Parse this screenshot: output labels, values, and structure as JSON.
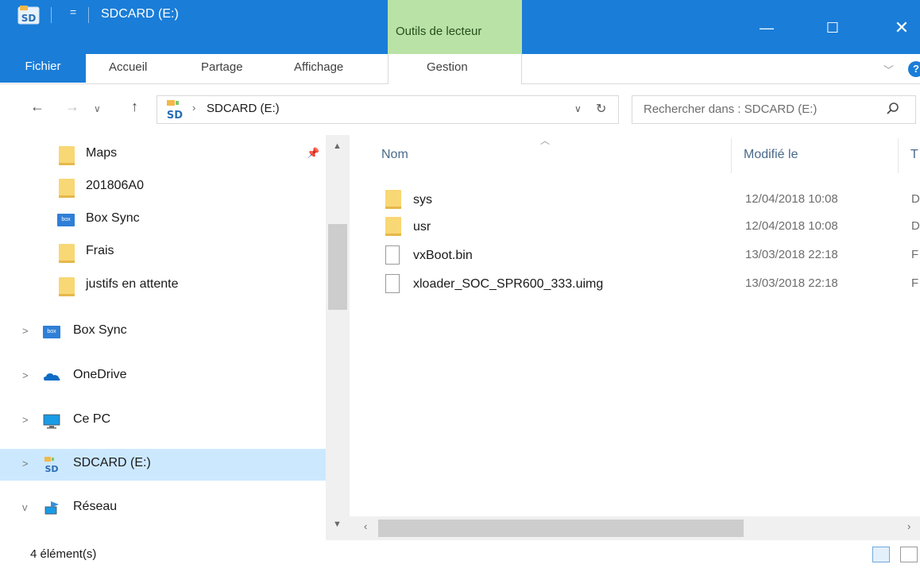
{
  "window": {
    "title": "SDCARD (E:)",
    "quick_access_glyph": "=",
    "context_tab_group": "Outils de lecteur",
    "controls": {
      "minimize": "—",
      "maximize": "☐",
      "close": "✕"
    },
    "accent_color": "#1a7dd8",
    "context_color": "#b9e2a6"
  },
  "ribbon": {
    "tabs": [
      "Fichier",
      "Accueil",
      "Partage",
      "Affichage",
      "Gestion"
    ],
    "collapse_glyph": "﹀",
    "help_glyph": "?"
  },
  "address": {
    "path": "SDCARD (E:)",
    "search_placeholder": "Rechercher dans : SDCARD (E:)"
  },
  "nav_pane": {
    "items": [
      {
        "label": "Maps",
        "icon": "folder-icon",
        "pinned": true
      },
      {
        "label": "201806A0",
        "icon": "folder-icon"
      },
      {
        "label": "Box Sync",
        "icon": "box-icon"
      },
      {
        "label": "Frais",
        "icon": "folder-icon"
      },
      {
        "label": "justifs en attente",
        "icon": "folder-icon"
      },
      {
        "label": "Box Sync",
        "icon": "box-icon",
        "expander": ">"
      },
      {
        "label": "OneDrive",
        "icon": "onedrive-icon",
        "expander": ">"
      },
      {
        "label": "Ce PC",
        "icon": "pc-icon",
        "expander": ">"
      },
      {
        "label": "SDCARD (E:)",
        "icon": "sdcard-icon",
        "expander": ">",
        "selected": true
      },
      {
        "label": "Réseau",
        "icon": "network-icon",
        "expander": "v"
      }
    ]
  },
  "file_list": {
    "columns": [
      "Nom",
      "Modifié le",
      "T"
    ],
    "rows": [
      {
        "name": "sys",
        "modified": "12/04/2018 10:08",
        "type": "D",
        "icon": "folder-icon"
      },
      {
        "name": "usr",
        "modified": "12/04/2018 10:08",
        "type": "D",
        "icon": "folder-icon"
      },
      {
        "name": "vxBoot.bin",
        "modified": "13/03/2018 22:18",
        "type": "F",
        "icon": "file-icon"
      },
      {
        "name": "xloader_SOC_SPR600_333.uimg",
        "modified": "13/03/2018 22:18",
        "type": "F",
        "icon": "file-icon"
      }
    ]
  },
  "status": {
    "item_count": "4 élément(s)"
  }
}
